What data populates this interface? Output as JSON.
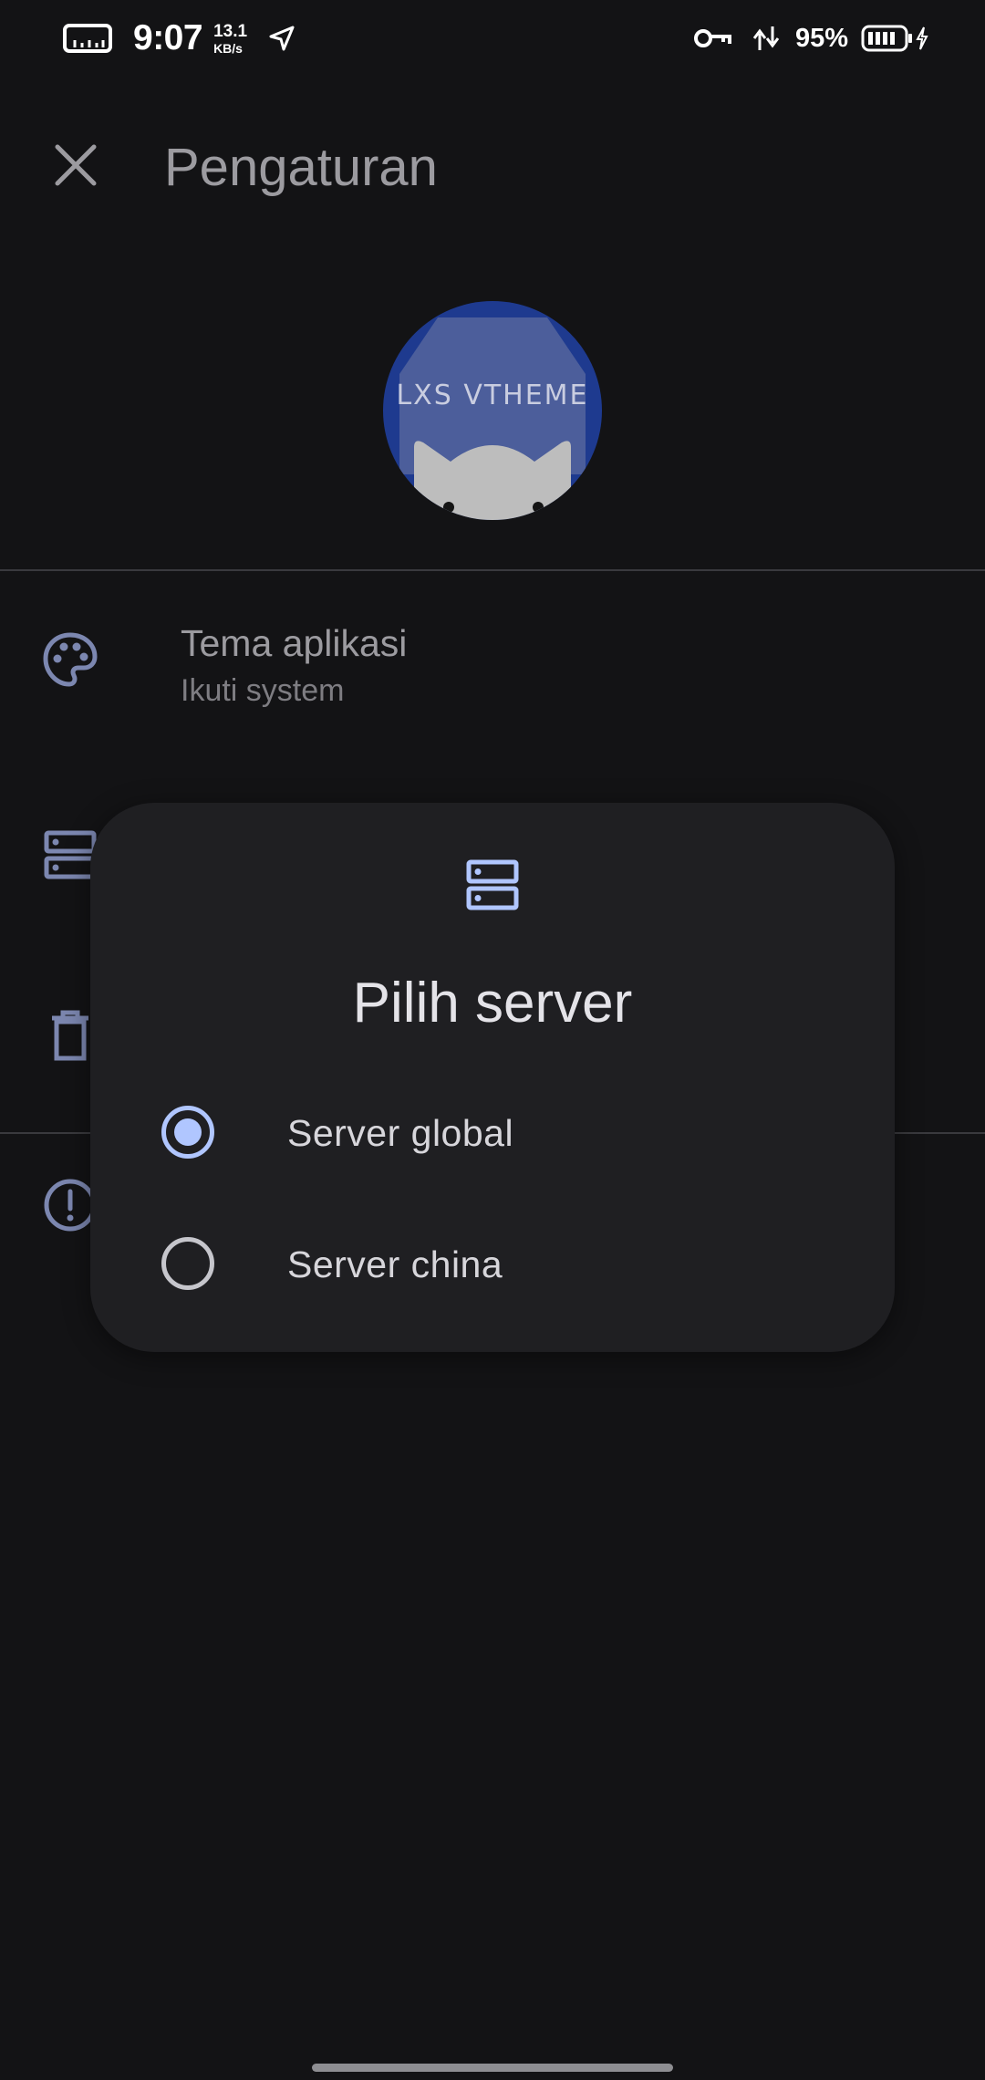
{
  "status_bar": {
    "time": "9:07",
    "net_speed_value": "13.1",
    "net_speed_unit": "KB/s",
    "battery_percent": "95%",
    "icons": [
      "ruler-icon",
      "navigation-icon",
      "vpn-key-icon",
      "data-transfer-icon",
      "battery-icon",
      "charging-icon"
    ]
  },
  "app_bar": {
    "title": "Pengaturan",
    "close_icon": "close-icon"
  },
  "header": {
    "logo_text": "LXS VTHEME"
  },
  "settings": {
    "items": [
      {
        "icon": "palette-icon",
        "title": "Tema aplikasi",
        "subtitle": "Ikuti system"
      },
      {
        "icon": "server-icon",
        "title": "",
        "subtitle": ""
      },
      {
        "icon": "delete-icon",
        "title": "",
        "subtitle": ""
      },
      {
        "icon": "alert-circle-icon",
        "title": "",
        "subtitle": ""
      }
    ]
  },
  "dialog": {
    "icon": "server-icon",
    "title": "Pilih server",
    "options": [
      {
        "label": "Server global",
        "selected": true
      },
      {
        "label": "Server china",
        "selected": false
      }
    ]
  },
  "colors": {
    "background": "#131315",
    "dialog_surface": "#1f1f22",
    "accent": "#b0c6ff",
    "icon_dimmed": "#7c87b0"
  }
}
